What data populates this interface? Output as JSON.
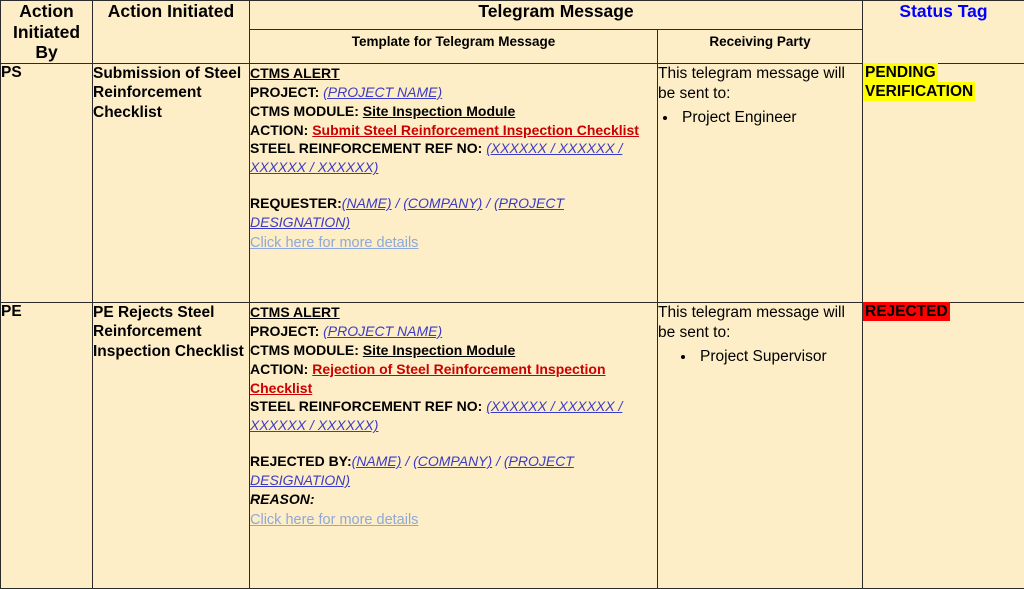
{
  "table": {
    "headers": {
      "action_initiated_by": "Action Initiated By",
      "action_initiated": "Action Initiated",
      "telegram_message": "Telegram Message",
      "template_for_telegram_message": "Template for Telegram Message",
      "receiving_party": "Receiving Party",
      "status_tag": "Status Tag"
    },
    "rows": [
      {
        "initiated_by": "PS",
        "action_initiated": "Submission of Steel Reinforcement Checklist",
        "message": {
          "alert_title": "CTMS ALERT",
          "project_label": "PROJECT:",
          "project_value": "(PROJECT NAME)",
          "module_label": "CTMS MODULE:",
          "module_value": "Site Inspection Module",
          "action_label": "ACTION:",
          "action_value": "Submit Steel Reinforcement Inspection Checklist",
          "ref_label": "STEEL REINFORCEMENT REF NO:",
          "ref_value": "(XXXXXX / XXXXXX / XXXXXX / XXXXXX)",
          "party_label": "REQUESTER:",
          "party_name": "(NAME)",
          "party_sep1": " / ",
          "party_company": "(COMPANY)",
          "party_sep2": " / ",
          "party_designation": "(PROJECT DESIGNATION)",
          "reason_label": "",
          "link_text": "Click here for more details"
        },
        "receiving": {
          "lead": "This telegram message will be sent to:",
          "parties": [
            "Project Engineer"
          ],
          "indented": false
        },
        "status": {
          "label": "PENDING VERIFICATION",
          "background": "#ffff00",
          "color": "#000000"
        }
      },
      {
        "initiated_by": "PE",
        "action_initiated": "PE Rejects Steel Reinforcement Inspection Checklist",
        "message": {
          "alert_title": "CTMS ALERT",
          "project_label": "PROJECT:",
          "project_value": "(PROJECT NAME)",
          "module_label": "CTMS MODULE:",
          "module_value": "Site Inspection Module",
          "action_label": "ACTION:",
          "action_value": "Rejection of Steel Reinforcement Inspection Checklist",
          "ref_label": "STEEL REINFORCEMENT REF NO:",
          "ref_value": "(XXXXXX / XXXXXX / XXXXXX / XXXXXX)",
          "party_label": "REJECTED BY:",
          "party_name": "(NAME)",
          "party_sep1": " / ",
          "party_company": "(COMPANY)",
          "party_sep2": " / ",
          "party_designation": "(PROJECT DESIGNATION)",
          "reason_label": "REASON:",
          "link_text": "Click here for more details"
        },
        "receiving": {
          "lead": "This telegram message will be sent to:",
          "parties": [
            "Project Supervisor"
          ],
          "indented": true
        },
        "status": {
          "label": "REJECTED",
          "background": "#ff0000",
          "color": "#000000"
        }
      }
    ]
  },
  "colors": {
    "header_background": "#bdd2ec",
    "body_background": "#fdeec8",
    "border": "#2b2b2b",
    "action_red": "#cc0000",
    "placeholder_blue": "#3b3bc4",
    "link_blue": "#8fa8d8",
    "status_heading_blue": "#0000ff"
  }
}
